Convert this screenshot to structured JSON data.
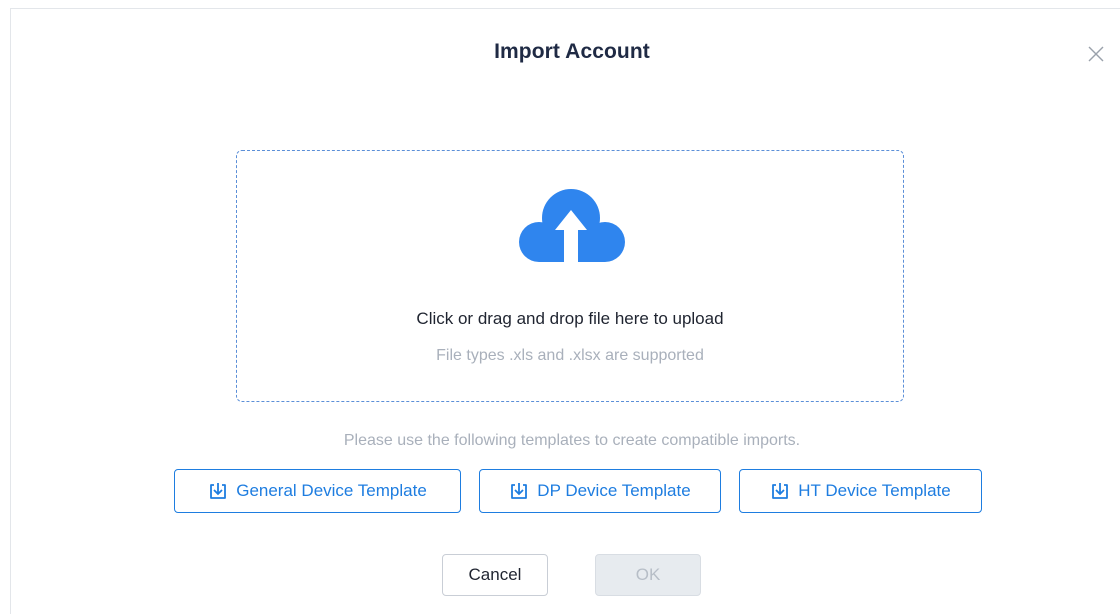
{
  "dialog": {
    "title": "Import Account",
    "close_icon": "close-icon"
  },
  "dropzone": {
    "icon": "cloud-upload-icon",
    "main_text": "Click or drag and drop file here to upload",
    "sub_text": "File types .xls and .xlsx are supported"
  },
  "templates": {
    "hint": "Please use the following templates to create compatible imports.",
    "buttons": [
      {
        "label": "General Device Template",
        "icon": "download-icon"
      },
      {
        "label": "DP Device Template",
        "icon": "download-icon"
      },
      {
        "label": "HT Device Template",
        "icon": "download-icon"
      }
    ]
  },
  "footer": {
    "cancel_label": "Cancel",
    "ok_label": "OK"
  },
  "colors": {
    "accent": "#1e7de0",
    "cloud": "#2f85ee",
    "muted_text": "#a9b0bb",
    "title_text": "#1f2a44"
  }
}
